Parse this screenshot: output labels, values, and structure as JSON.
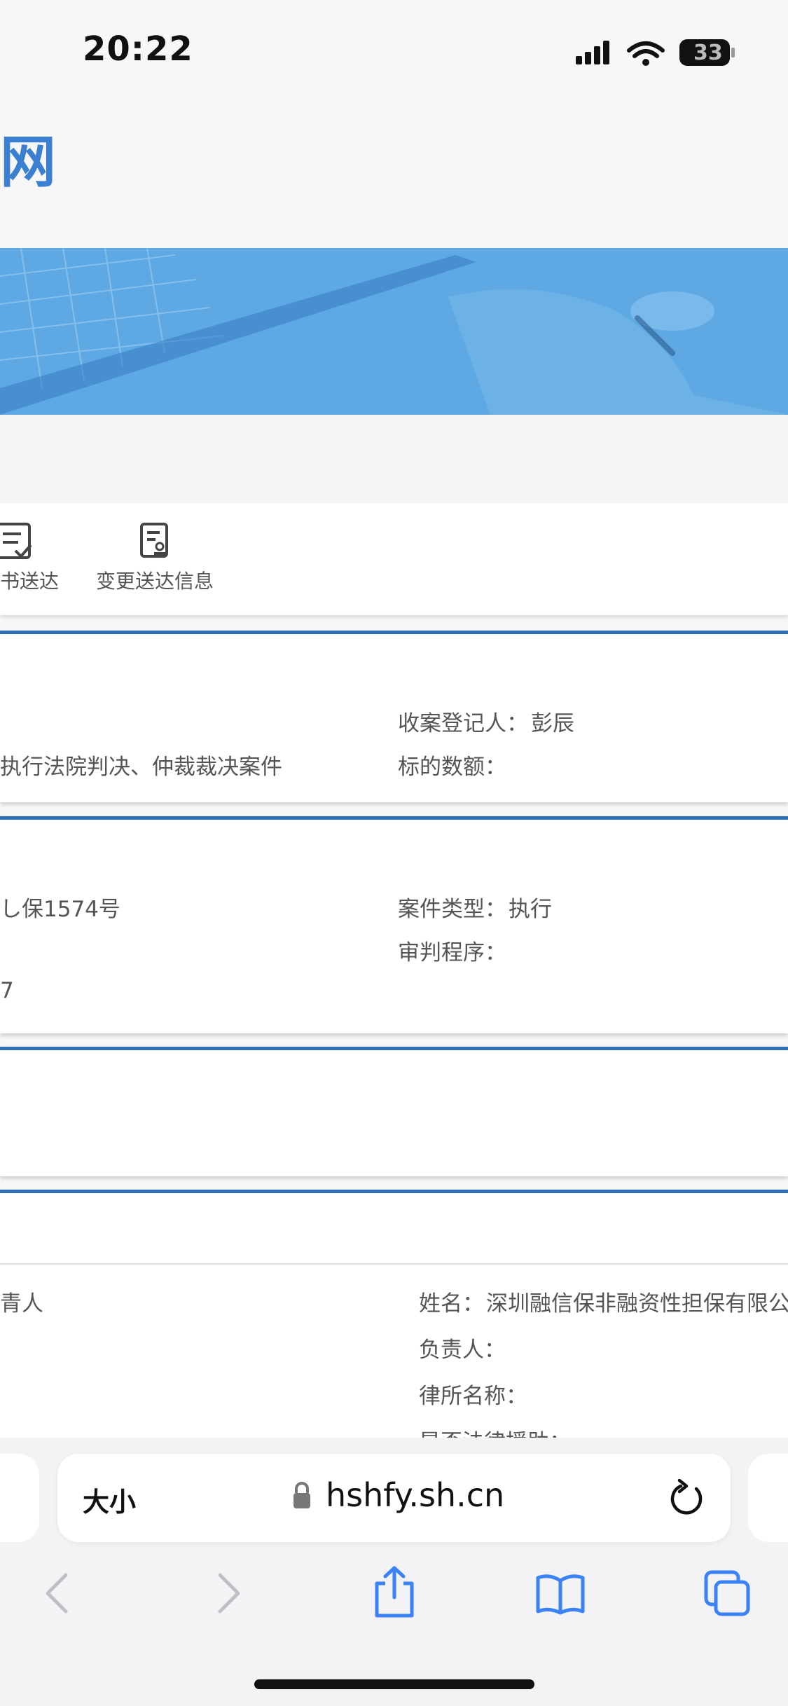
{
  "status_bar": {
    "time": "20:22",
    "battery": "33"
  },
  "header": {
    "logo_fragment": "网"
  },
  "nav": {
    "item1_label": "书送达",
    "item2_label": "变更送达信息"
  },
  "case_info": {
    "registrar_label": "收案登记人：",
    "registrar_value": "彭辰",
    "cause_fragment": "执行法院判决、仲裁裁决案件",
    "amount_label": "标的数额："
  },
  "case_detail": {
    "number_fragment": "し保1574号",
    "type_label": "案件类型：",
    "type_value": "执行",
    "procedure_label": "审判程序：",
    "date_fragment": "7"
  },
  "party": {
    "role_fragment": "青人",
    "name_label": "姓名：",
    "name_value": "深圳融信保非融资性担保有限公",
    "principal_label": "负责人：",
    "lawfirm_label": "律所名称：",
    "legalaid_label": "是否法律援助："
  },
  "browser": {
    "text_size_label": "大小",
    "url": "hshfy.sh.cn"
  },
  "colors": {
    "accent": "#2f6fb8",
    "banner": "#5ea9e4",
    "link_blue": "#3b82f6"
  }
}
